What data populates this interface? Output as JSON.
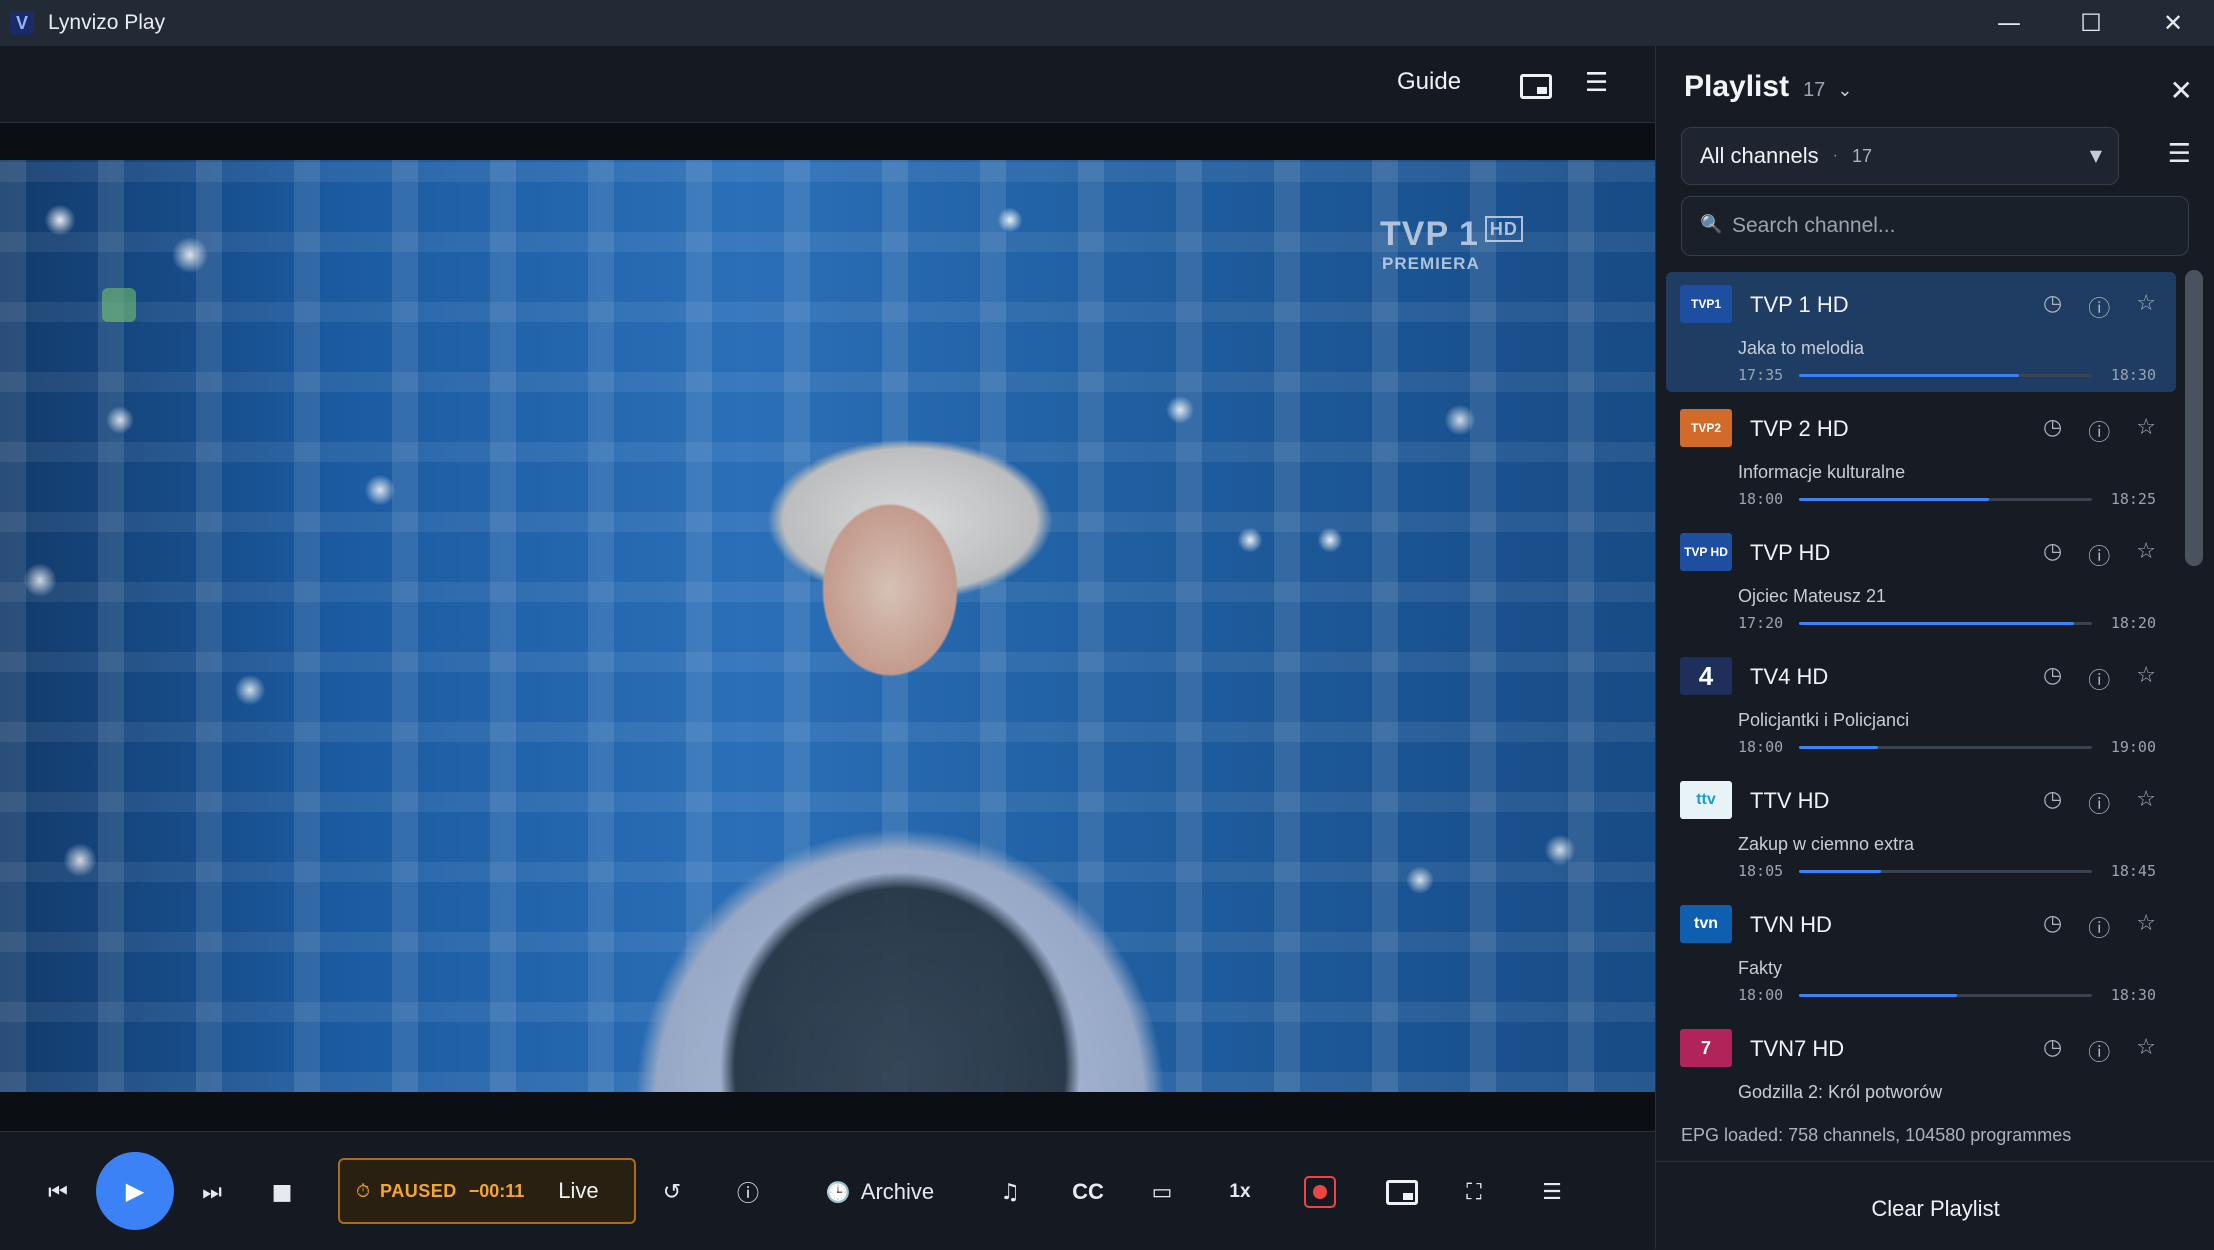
{
  "window": {
    "logo_letter": "V",
    "title": "Lynvizo Play",
    "minimize_glyph": "—",
    "maximize_glyph": "☐",
    "close_glyph": "✕"
  },
  "player": {
    "guide_label": "Guide",
    "menu_glyph": "☰",
    "watermark": {
      "brand": "TVP 1",
      "hd": "HD",
      "sub": "PREMIERA"
    }
  },
  "controls": {
    "prev_glyph": "⏮",
    "play_glyph": "▶",
    "next_glyph": "⏭",
    "stop_glyph": "■",
    "paused_icon": "⏱",
    "paused_label": "PAUSED",
    "paused_offset": "−00:11",
    "live_label": "Live",
    "replay_glyph": "↺",
    "info_glyph": "ⓘ",
    "archive_glyph": "🕒",
    "archive_label": "Archive",
    "audio_glyph": "♫",
    "cc_label": "CC",
    "aspect_glyph": "▭",
    "speed_label": "1x",
    "fullscreen_glyph": "⛶",
    "menu_glyph": "☰"
  },
  "playlist": {
    "title": "Playlist",
    "count": "17",
    "chevron_glyph": "⌄",
    "close_glyph": "✕",
    "filter": {
      "label": "All channels",
      "dot": "·",
      "count": "17",
      "arrow_glyph": "▼"
    },
    "menu_glyph": "☰",
    "search": {
      "icon_glyph": "🔍",
      "placeholder": "Search channel..."
    },
    "item_icons": {
      "clock": "◷",
      "info": "ⓘ",
      "star": "☆"
    },
    "channels": [
      {
        "name": "TVP 1 HD",
        "logo_text": "TVP1",
        "logo_color": "#1d4ea0",
        "program": "Jaka to melodia",
        "start": "17:35",
        "end": "18:30",
        "progress": 0.75
      },
      {
        "name": "TVP 2 HD",
        "logo_text": "TVP2",
        "logo_color": "#d26a2a",
        "program": "Informacje kulturalne",
        "start": "18:00",
        "end": "18:25",
        "progress": 0.65
      },
      {
        "name": "TVP HD",
        "logo_text": "TVP HD",
        "logo_color": "#1d4ea0",
        "program": "Ojciec Mateusz 21",
        "start": "17:20",
        "end": "18:20",
        "progress": 0.94
      },
      {
        "name": "TV4 HD",
        "logo_text": "4",
        "logo_color": "#1e2f5c",
        "program": "Policjantki i Policjanci",
        "start": "18:00",
        "end": "19:00",
        "progress": 0.27
      },
      {
        "name": "TTV HD",
        "logo_text": "ttv",
        "logo_color": "#e8f3f8",
        "program": "Zakup w ciemno extra",
        "start": "18:05",
        "end": "18:45",
        "progress": 0.28
      },
      {
        "name": "TVN HD",
        "logo_text": "tvn",
        "logo_color": "#0f5fb0",
        "program": "Fakty",
        "start": "18:00",
        "end": "18:30",
        "progress": 0.54
      },
      {
        "name": "TVN7 HD",
        "logo_text": "7",
        "logo_color": "#b0245a",
        "program": "Godzilla 2: Król potworów",
        "start": "",
        "end": "",
        "progress": 0
      }
    ],
    "epg_status": "EPG loaded: 758 channels, 104580 programmes",
    "clear_label": "Clear Playlist"
  },
  "colors": {
    "accent": "#3b82f6",
    "paused": "#f3a536",
    "record": "#ef4444",
    "active_row": "#1f3c63"
  }
}
